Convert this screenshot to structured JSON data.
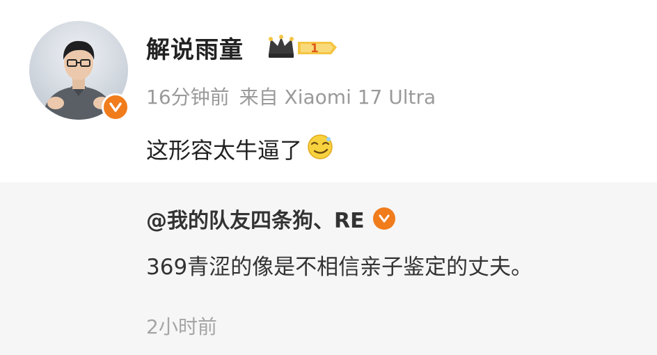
{
  "post": {
    "username": "解说雨童",
    "time": "16分钟前",
    "source": "来自 Xiaomi 17 Ultra",
    "content": "这形容太牛逼了",
    "emoji": "smirk-emoji",
    "vip_level": "1"
  },
  "quote": {
    "author": "@我的队友四条狗、RE",
    "text": "369青涩的像是不相信亲子鉴定的丈夫。",
    "time": "2小时前"
  },
  "colors": {
    "verified_badge": "#f07c1c",
    "quote_background": "#f6f6f6",
    "meta_text": "#9a9a9a"
  }
}
